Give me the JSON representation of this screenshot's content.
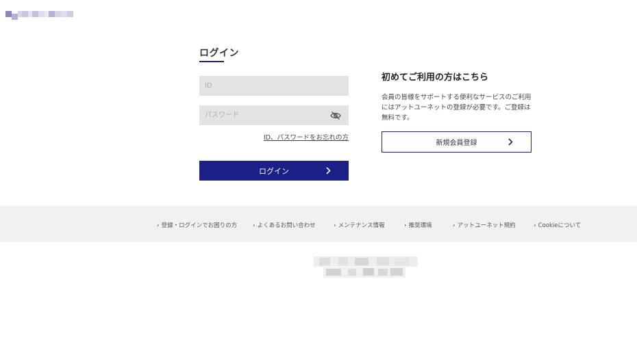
{
  "header": {
    "logo_alt": "site-logo"
  },
  "login": {
    "title": "ログイン",
    "id_placeholder": "ID",
    "password_placeholder": "パスワード",
    "forgot_link": "ID、パスワードをお忘れの方",
    "login_button": "ログイン"
  },
  "register": {
    "heading": "初めてご利用の方はこちら",
    "description": "会員の皆様をサポートする便利なサービスのご利用にはアットユーネットの登録が必要です。ご登録は無料です。",
    "button": "新規会員登録"
  },
  "footer": {
    "links": [
      "登録・ログインでお困りの方",
      "よくあるお問い合わせ",
      "メンテナンス情報",
      "推奨環境",
      "アットユーネット規約",
      "Cookieについて"
    ]
  },
  "colors": {
    "accent": "#1b1f86",
    "field_bg": "#e3e3e3",
    "footer_bg": "#f1f1f1"
  },
  "icons": {
    "eye": "eye-slash-icon",
    "chevron": "chevron-right-icon",
    "footer_arrow": "small-chevron-right-icon"
  }
}
